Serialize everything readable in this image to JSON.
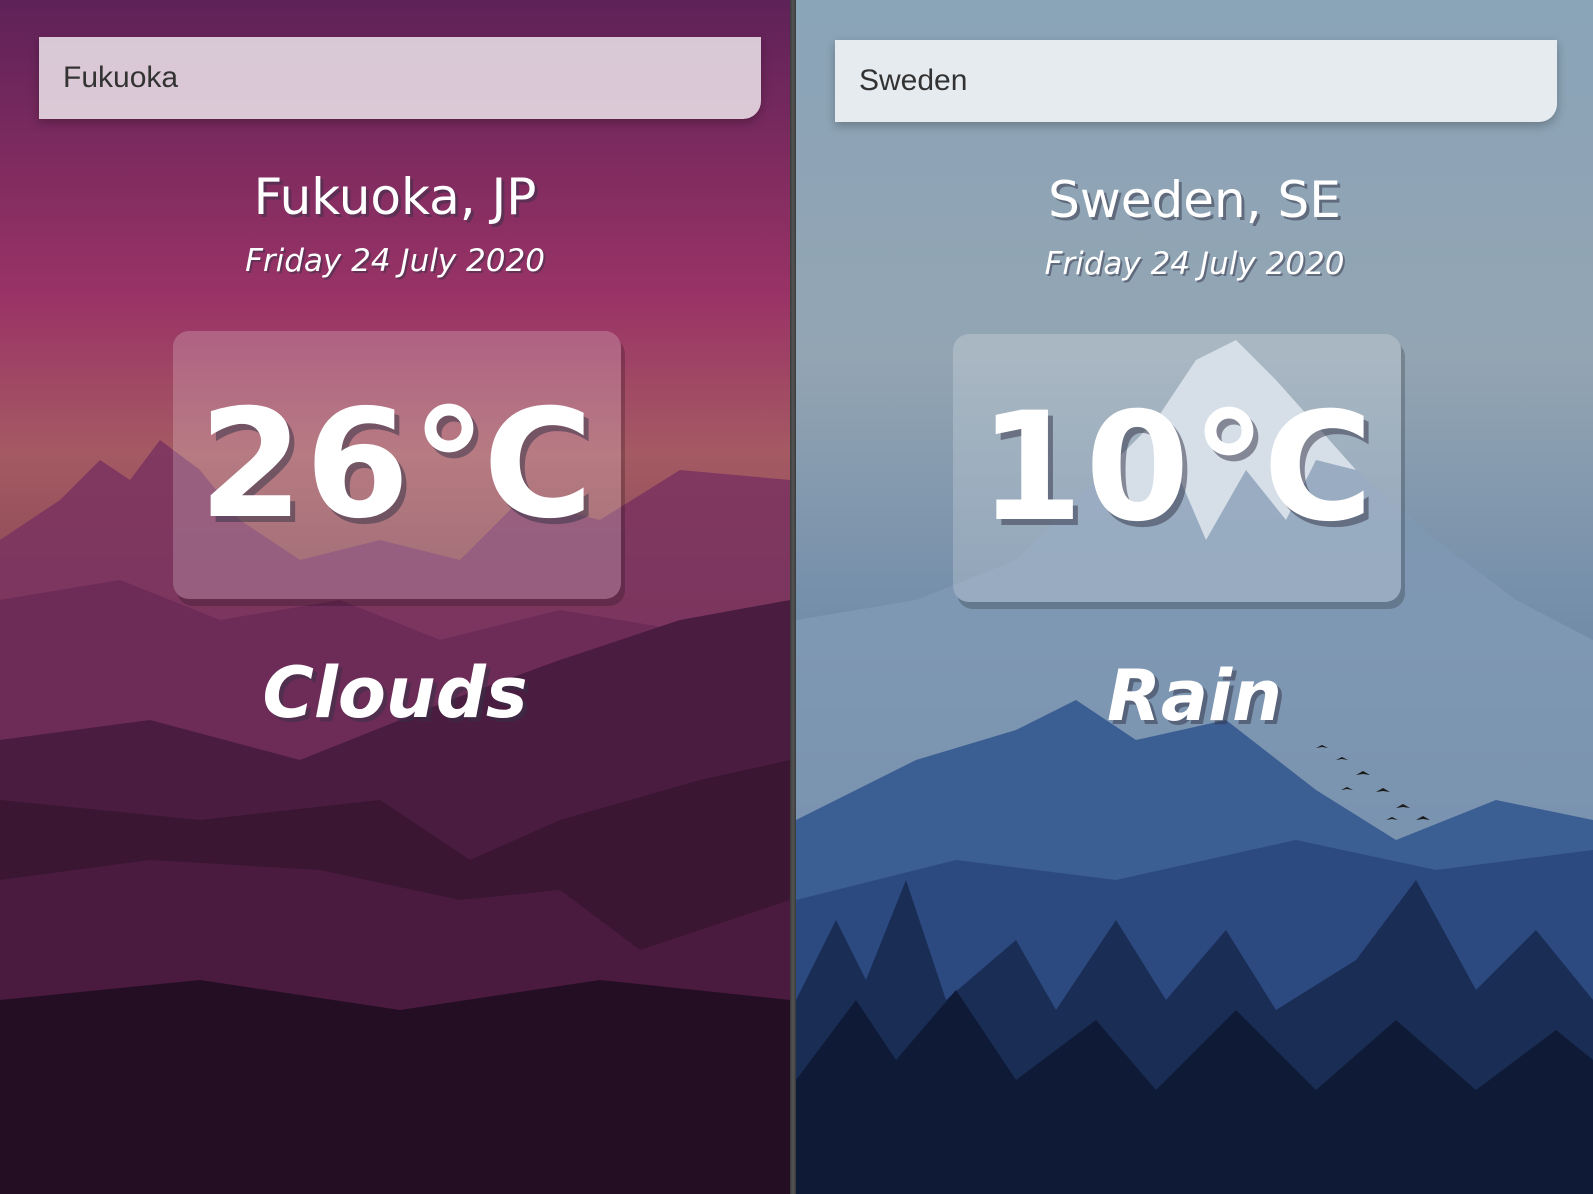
{
  "theme": {
    "warm_top": "#5e2258",
    "warm_mid": "#9a3366",
    "warm_bottom": "#1e0f22",
    "cool_top": "#8aa4b8",
    "cool_mid": "#4c6d9a",
    "cool_bottom": "#0e1a33"
  },
  "panels": [
    {
      "search": {
        "value": "Fukuoka"
      },
      "location": "Fukuoka, JP",
      "date": "Friday 24 July 2020",
      "temperature": "26℃",
      "condition": "Clouds"
    },
    {
      "search": {
        "value": "Sweden"
      },
      "location": "Sweden, SE",
      "date": "Friday 24 July 2020",
      "temperature": "10℃",
      "condition": "Rain"
    }
  ]
}
